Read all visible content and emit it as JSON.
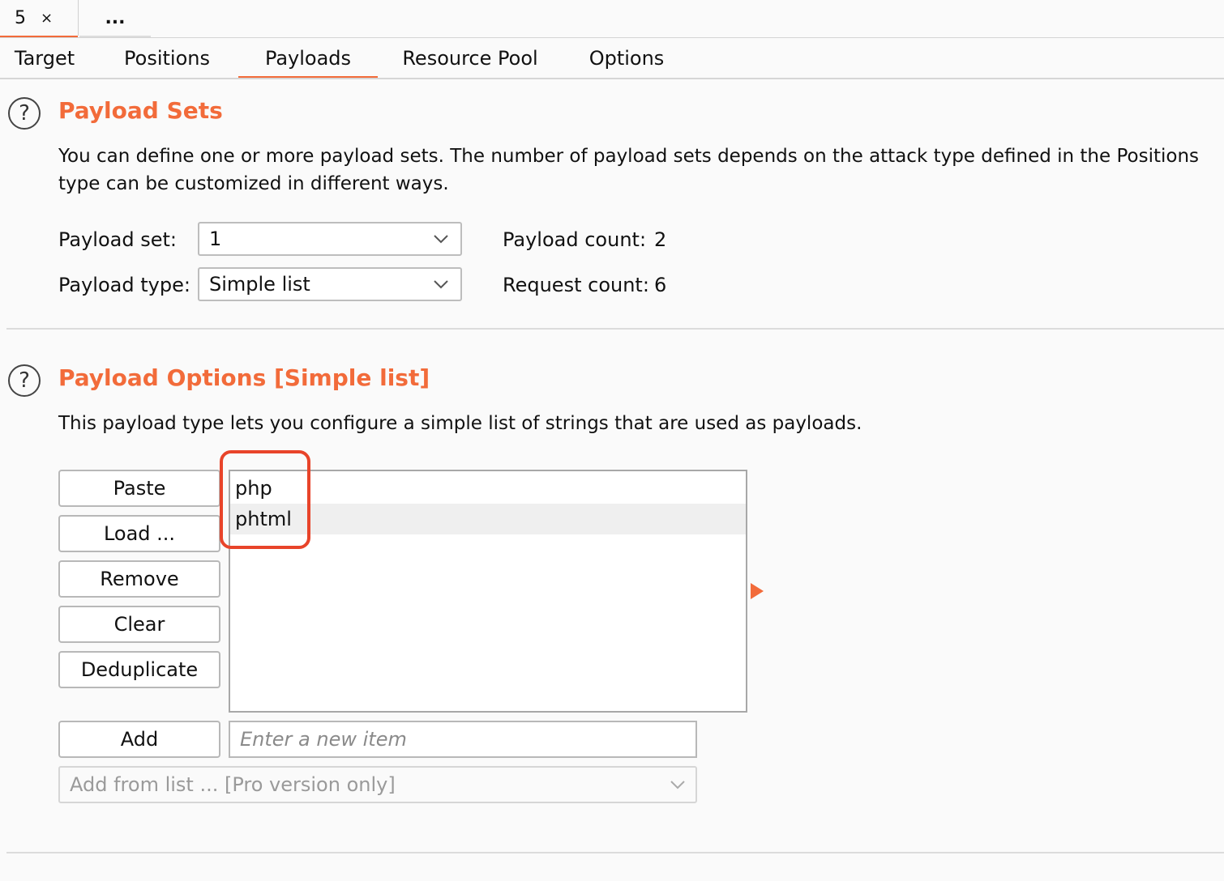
{
  "session_tabs": [
    {
      "label": "5",
      "close": "×"
    },
    {
      "label": "..."
    }
  ],
  "tabs": [
    "Target",
    "Positions",
    "Payloads",
    "Resource Pool",
    "Options"
  ],
  "active_tab": "Payloads",
  "payload_sets": {
    "help": "?",
    "title": "Payload Sets",
    "desc_line1": "You can define one or more payload sets. The number of payload sets depends on the attack type defined in the Positions",
    "desc_line2": "type can be customized in different ways.",
    "set_label": "Payload set:",
    "set_value": "1",
    "type_label": "Payload type:",
    "type_value": "Simple list",
    "payload_count_label": "Payload count:",
    "payload_count": "2",
    "request_count_label": "Request count:",
    "request_count": "6"
  },
  "payload_options": {
    "help": "?",
    "title": "Payload Options [Simple list]",
    "desc": "This payload type lets you configure a simple list of strings that are used as payloads.",
    "buttons": {
      "paste": "Paste",
      "load": "Load ...",
      "remove": "Remove",
      "clear": "Clear",
      "deduplicate": "Deduplicate",
      "add": "Add"
    },
    "items": [
      "php",
      "phtml"
    ],
    "new_item_placeholder": "Enter a new item",
    "add_from_list": "Add from list ... [Pro version only]"
  },
  "colors": {
    "accent": "#f26b3a",
    "highlight": "#e8442a"
  },
  "icons": [
    "close-icon",
    "help-icon",
    "chevron-down-icon",
    "arrow-right-icon"
  ]
}
